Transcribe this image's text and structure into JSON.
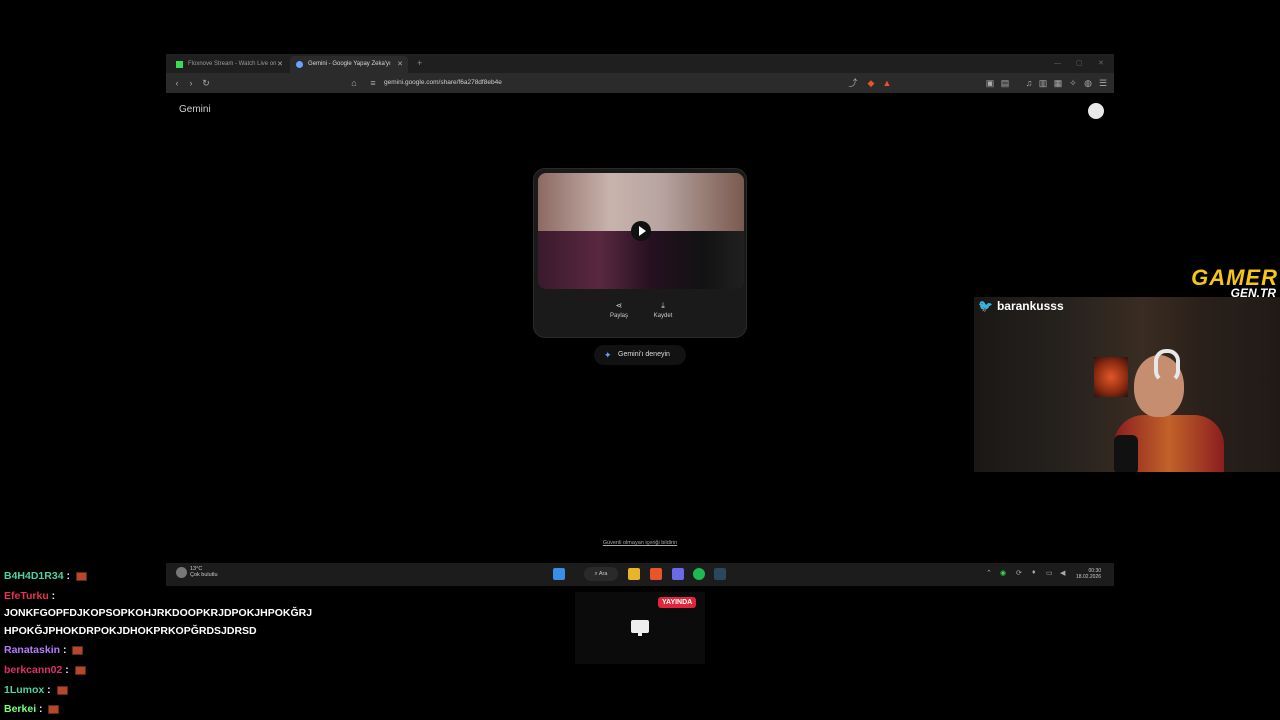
{
  "browser": {
    "tabs": [
      {
        "title": "Floxnove Stream - Watch Live on",
        "active": false
      },
      {
        "title": "Gemini - Google Yapay Zeka'yı",
        "active": true
      }
    ],
    "new_tab": "+",
    "url": "gemini.google.com/share/f6a278df8eb4e"
  },
  "page": {
    "logo": "Gemini",
    "card_actions": {
      "share": "Paylaş",
      "save": "Kaydet"
    },
    "try_button": "Gemini'ı deneyin",
    "report_link": "Güvenli olmayan içeriği bildirin"
  },
  "taskbar": {
    "weather_temp": "13°C",
    "weather_desc": "Çok bulutlu",
    "search_label": "Ara",
    "time": "00:30",
    "date": "18.02.2026"
  },
  "overlay": {
    "brand_main": "GAMER",
    "brand_sub": "GEN.TR",
    "handle": "barankusss",
    "live_badge": "YAYINDA"
  },
  "chat": [
    {
      "user": "B4H4D1R34",
      "color": "#4fd1a5",
      "message": "",
      "emote": true
    },
    {
      "user": "EfeTurku",
      "color": "#e8344a",
      "message": "",
      "emote": false
    },
    {
      "user": "",
      "color": "#ffffff",
      "message": "JONKFGOPFDJKOPSOPKOHJRKDOOPKRJDPOKJHPOKĞRJ",
      "emote": false
    },
    {
      "user": "",
      "color": "#ffffff",
      "message": "HPOKĞJPHOKDRPOKJDHOKPRKOPĞRDSJDRSD",
      "emote": false
    },
    {
      "user": "Ranataskin",
      "color": "#b57cff",
      "message": "",
      "emote": true
    },
    {
      "user": "berkcann02",
      "color": "#e0306b",
      "message": "",
      "emote": true
    },
    {
      "user": "1Lumox",
      "color": "#4fd1a5",
      "message": "",
      "emote": true
    },
    {
      "user": "Berkei",
      "color": "#7cff7a",
      "message": "",
      "emote": true
    }
  ],
  "colors": {
    "accent": "#f5c518",
    "live": "#e1253a",
    "twitter": "#1da1f2"
  }
}
